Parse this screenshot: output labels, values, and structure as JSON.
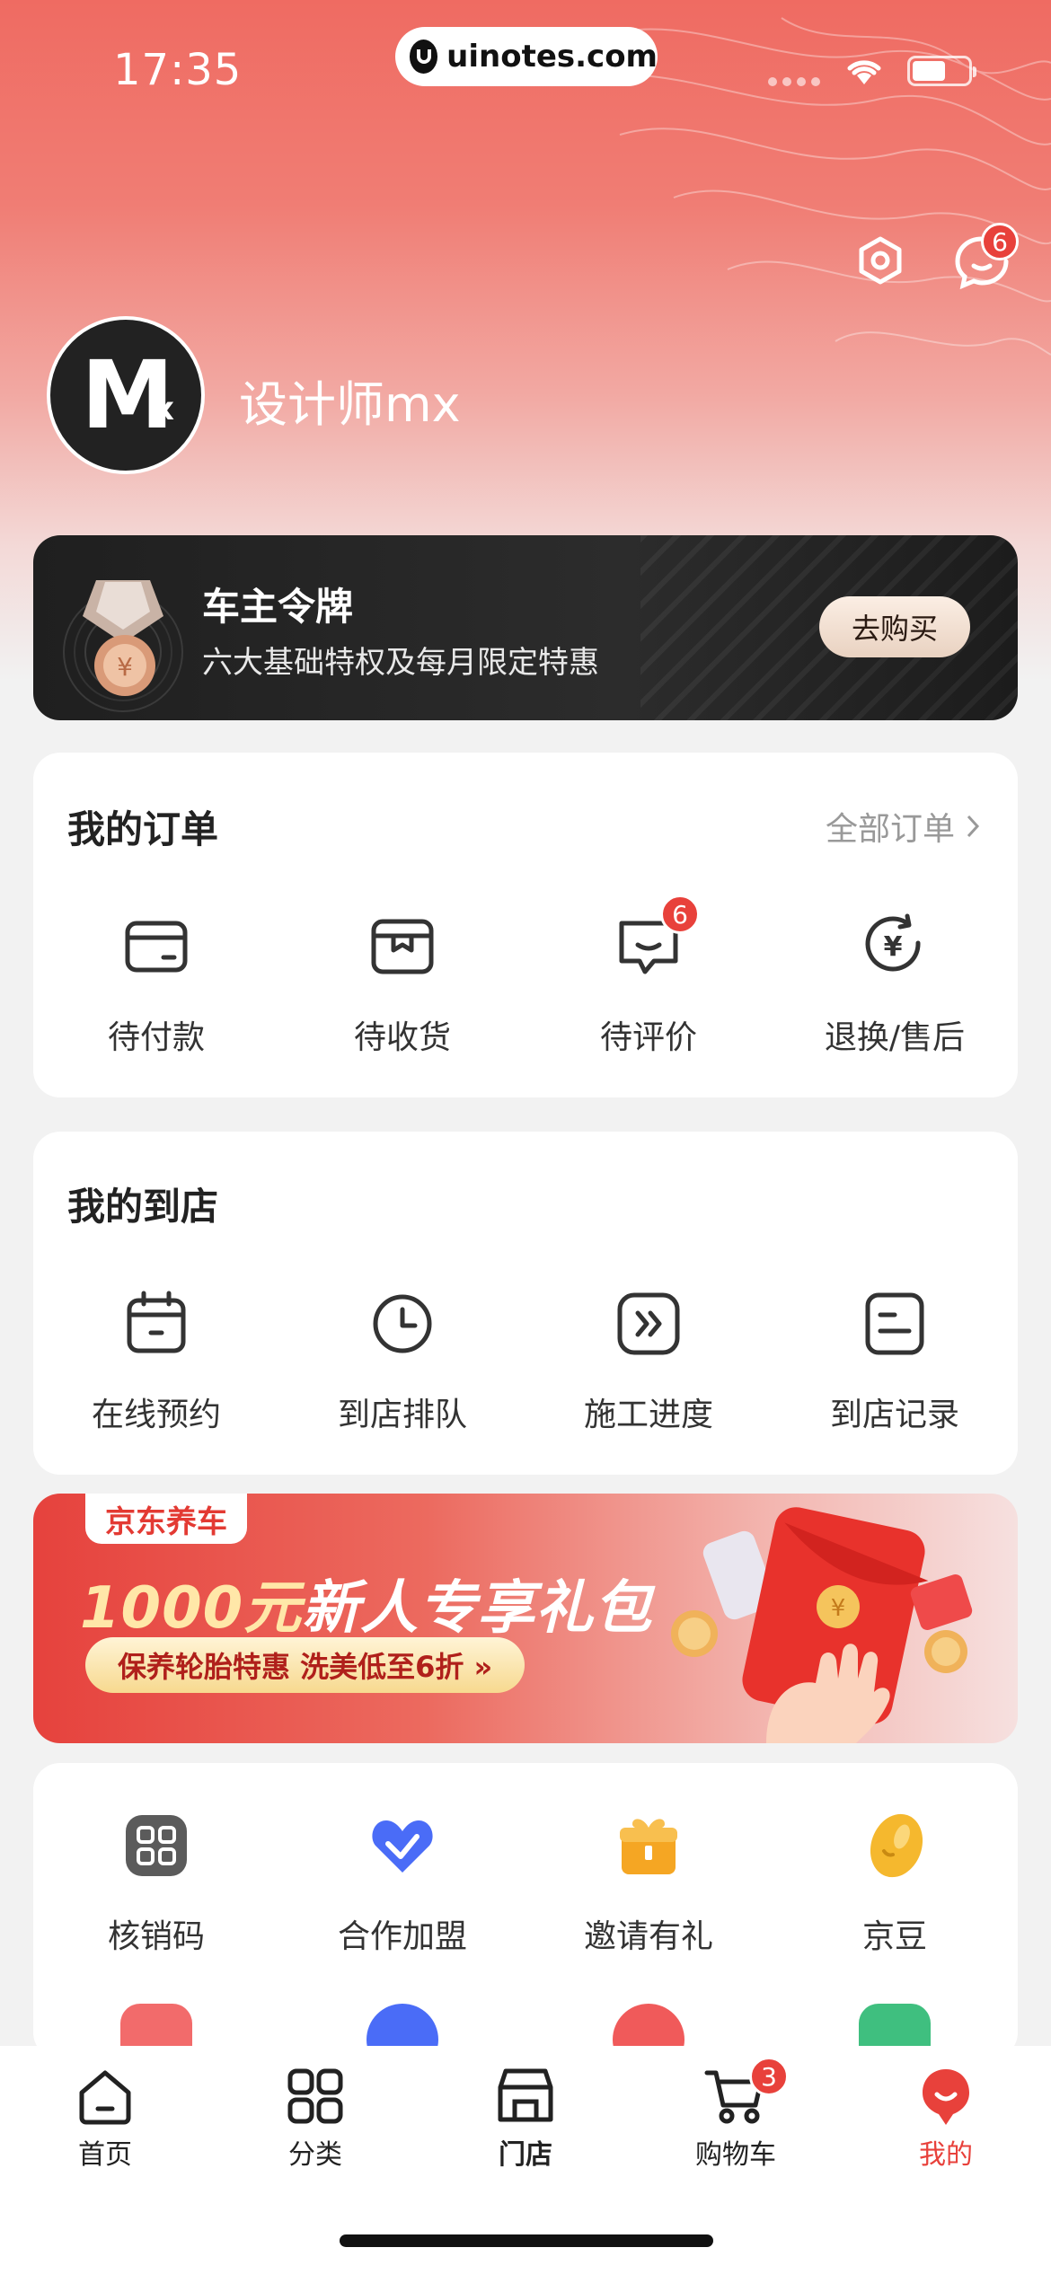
{
  "status": {
    "time": "17:35",
    "watermark": "uinotes.com"
  },
  "header": {
    "username": "设计师mx",
    "message_badge": "6"
  },
  "membership": {
    "title": "车主令牌",
    "subtitle": "六大基础特权及每月限定特惠",
    "button": "去购买"
  },
  "orders": {
    "title": "我的订单",
    "more": "全部订单",
    "items": [
      {
        "label": "待付款",
        "icon": "wallet-icon"
      },
      {
        "label": "待收货",
        "icon": "package-icon"
      },
      {
        "label": "待评价",
        "icon": "review-icon",
        "badge": "6"
      },
      {
        "label": "退换/售后",
        "icon": "refund-icon"
      }
    ]
  },
  "store": {
    "title": "我的到店",
    "items": [
      {
        "label": "在线预约",
        "icon": "calendar-icon"
      },
      {
        "label": "到店排队",
        "icon": "clock-icon"
      },
      {
        "label": "施工进度",
        "icon": "progress-icon"
      },
      {
        "label": "到店记录",
        "icon": "record-icon"
      }
    ]
  },
  "promo": {
    "tag": "京东养车",
    "headline_amount": "1000元",
    "headline_rest": "新人专享礼包",
    "pill": "保养轮胎特惠 洗美低至6折 »"
  },
  "tools": {
    "items": [
      {
        "label": "核销码",
        "icon": "qrcode-icon",
        "color": "#555555"
      },
      {
        "label": "合作加盟",
        "icon": "handshake-icon",
        "color": "#4a6cf7"
      },
      {
        "label": "邀请有礼",
        "icon": "gift-icon",
        "color": "#f5a623"
      },
      {
        "label": "京豆",
        "icon": "bean-icon",
        "color": "#f5b82e"
      }
    ]
  },
  "tabbar": {
    "items": [
      {
        "label": "首页",
        "icon": "home-icon"
      },
      {
        "label": "分类",
        "icon": "category-icon"
      },
      {
        "label": "门店",
        "icon": "store-icon"
      },
      {
        "label": "购物车",
        "icon": "cart-icon",
        "badge": "3"
      },
      {
        "label": "我的",
        "icon": "profile-icon"
      }
    ]
  },
  "colors": {
    "accent": "#e8413b",
    "hero_top": "#ef6b62"
  }
}
